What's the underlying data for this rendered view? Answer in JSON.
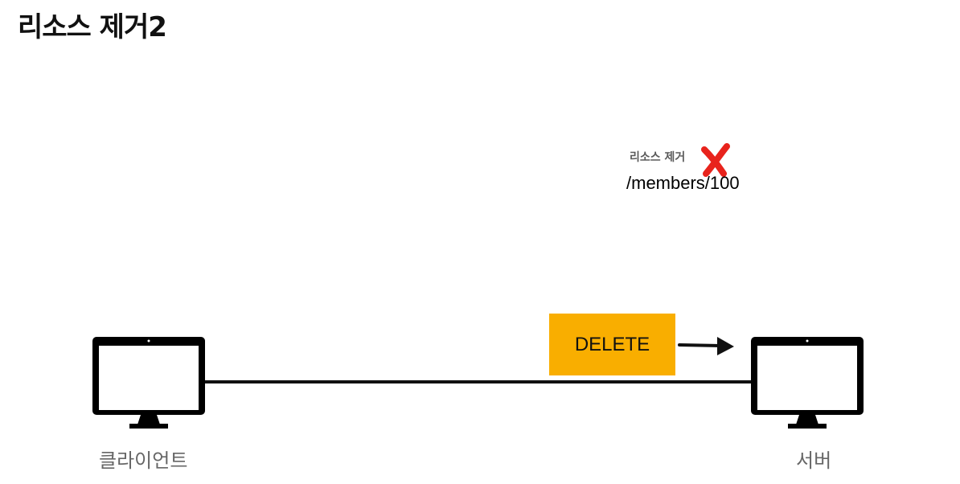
{
  "title": "리소스 제거2",
  "resource": {
    "note": "리소스 제거",
    "path": "/members/100",
    "x_mark_color": "#e8231c"
  },
  "request": {
    "method": "DELETE",
    "box_color": "#f9ae00"
  },
  "nodes": {
    "client_label": "클라이언트",
    "server_label": "서버",
    "client_icon": "monitor-icon",
    "server_icon": "monitor-icon"
  }
}
